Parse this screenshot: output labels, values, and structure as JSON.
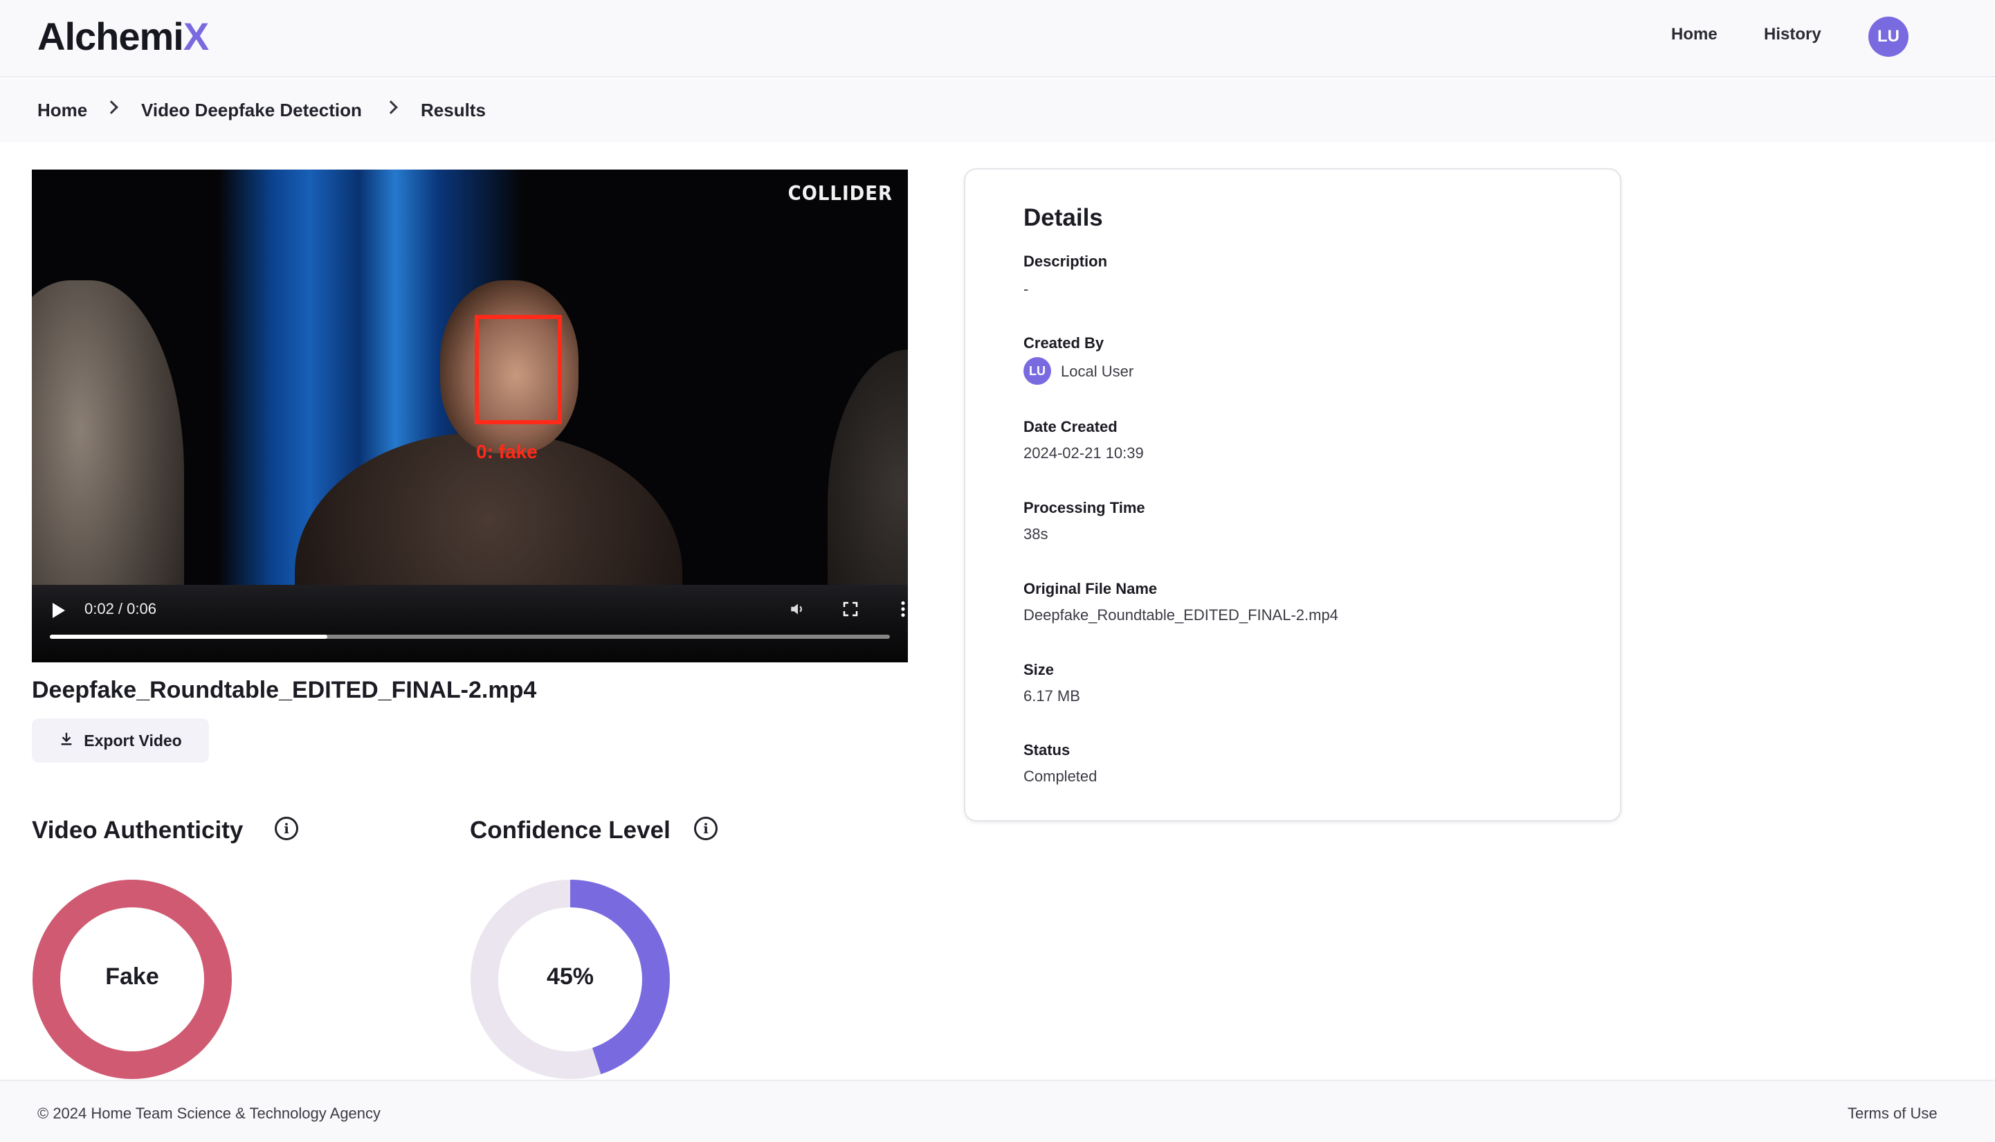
{
  "header": {
    "logo_main": "Alchemi",
    "logo_accent": "X",
    "nav_home": "Home",
    "nav_history": "History",
    "avatar_initials": "LU",
    "accent_color": "#7a6ae0"
  },
  "breadcrumb": {
    "items": [
      "Home",
      "Video Deepfake Detection",
      "Results"
    ]
  },
  "video": {
    "watermark": "COLLIDER",
    "face_label": "0: fake",
    "current_time": "0:02",
    "duration": "0:06",
    "time_display": "0:02 / 0:06",
    "progress_fraction": 0.33,
    "icons": [
      "play-icon",
      "volume-icon",
      "fullscreen-icon",
      "more-vertical-icon"
    ]
  },
  "file": {
    "name": "Deepfake_Roundtable_EDITED_FINAL-2.mp4",
    "export_label": "Export Video",
    "export_icon": "download-icon"
  },
  "metrics": {
    "authenticity": {
      "title": "Video Authenticity",
      "value": "Fake",
      "color": "#cf5a72",
      "fraction": 1.0
    },
    "confidence": {
      "title": "Confidence Level",
      "value": "45%",
      "percent": 45,
      "color": "#7a6ae0",
      "track_color": "#ebe5ef"
    }
  },
  "details": {
    "title": "Details",
    "description_label": "Description",
    "description_value": "-",
    "created_by_label": "Created By",
    "created_by_initials": "LU",
    "created_by_value": "Local User",
    "date_label": "Date Created",
    "date_value": "2024-02-21 10:39",
    "processing_label": "Processing Time",
    "processing_value": "38s",
    "filename_label": "Original File Name",
    "filename_value": "Deepfake_Roundtable_EDITED_FINAL-2.mp4",
    "size_label": "Size",
    "size_value": "6.17 MB",
    "status_label": "Status",
    "status_value": "Completed"
  },
  "footer": {
    "copyright": "© 2024 Home Team Science & Technology Agency",
    "terms": "Terms of Use"
  }
}
